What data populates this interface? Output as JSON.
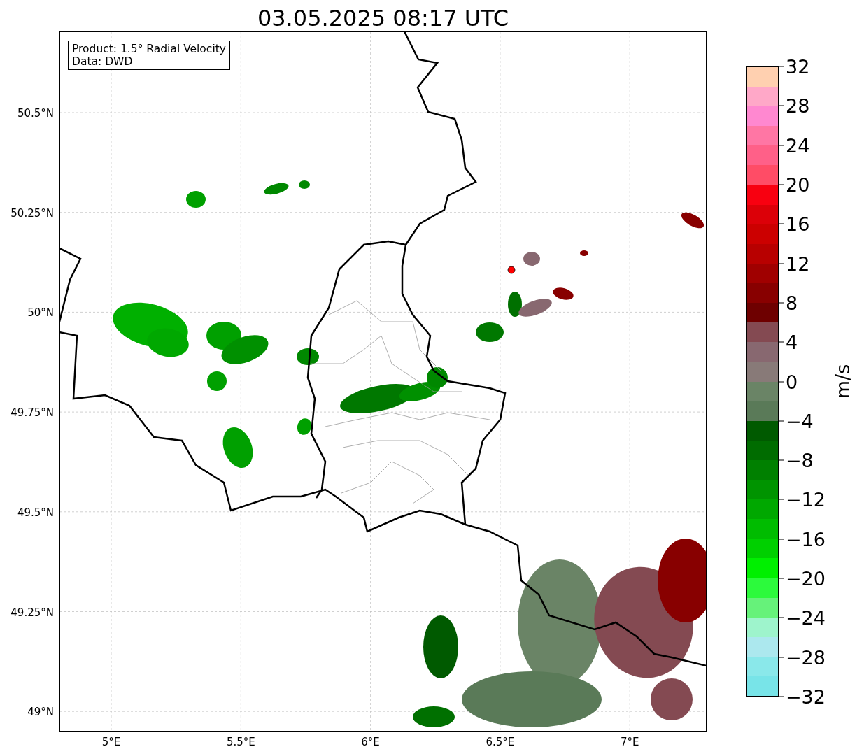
{
  "title": "03.05.2025 08:17 UTC",
  "info_box": [
    "Product: 1.5° Radial Velocity",
    "Data: DWD"
  ],
  "x_ticks": [
    "5°E",
    "5.5°E",
    "6°E",
    "6.5°E",
    "7°E"
  ],
  "y_ticks": [
    "50.5°N",
    "50.25°N",
    "50°N",
    "49.75°N",
    "49.5°N",
    "49.25°N",
    "49°N"
  ],
  "colorbar": {
    "label": "m/s",
    "ticks": [
      "32",
      "28",
      "24",
      "20",
      "16",
      "12",
      "8",
      "4",
      "0",
      "−4",
      "−8",
      "−12",
      "−16",
      "−20",
      "−24",
      "−28",
      "−32"
    ],
    "segments": [
      {
        "color": "#ffd0b0"
      },
      {
        "color": "#ffa8c8"
      },
      {
        "color": "#ff88d0"
      },
      {
        "color": "#ff76a4"
      },
      {
        "color": "#ff6088"
      },
      {
        "color": "#ff4c66"
      },
      {
        "color": "#f80010"
      },
      {
        "color": "#dc0008"
      },
      {
        "color": "#cc0000"
      },
      {
        "color": "#b80000"
      },
      {
        "color": "#a00000"
      },
      {
        "color": "#880000"
      },
      {
        "color": "#6e0000"
      },
      {
        "color": "#844a52"
      },
      {
        "color": "#886870"
      },
      {
        "color": "#887a78"
      },
      {
        "color": "#6a8466"
      },
      {
        "color": "#5a7a58"
      },
      {
        "color": "#005a00"
      },
      {
        "color": "#006c00"
      },
      {
        "color": "#008000"
      },
      {
        "color": "#009400"
      },
      {
        "color": "#00a800"
      },
      {
        "color": "#00bc00"
      },
      {
        "color": "#00d000"
      },
      {
        "color": "#00f000"
      },
      {
        "color": "#2cfa3c"
      },
      {
        "color": "#66f27a"
      },
      {
        "color": "#9ef4cc"
      },
      {
        "color": "#ace8ee"
      },
      {
        "color": "#8ae8ea"
      },
      {
        "color": "#78e4e8"
      }
    ]
  }
}
